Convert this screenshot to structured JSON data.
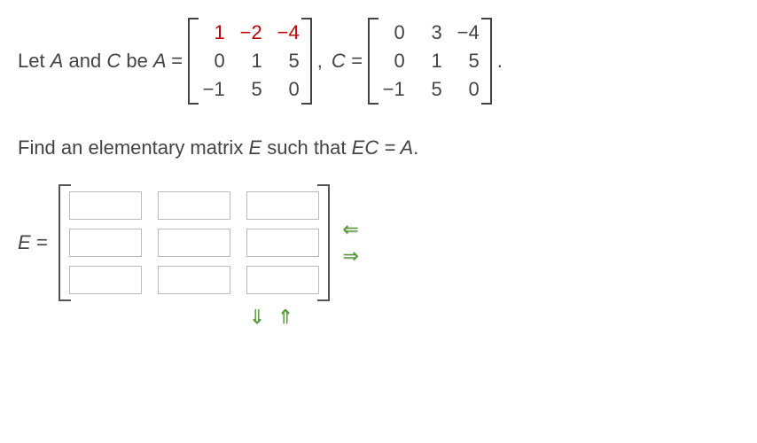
{
  "problem": {
    "intro_prefix": "Let ",
    "var_a": "A",
    "intro_mid": " and ",
    "var_c": "C",
    "intro_suffix": " be  ",
    "a_eq": "A =",
    "c_eq": "C =",
    "comma": ",",
    "period": ".",
    "matrix_a": [
      [
        "1",
        "−2",
        "−4"
      ],
      [
        "0",
        "1",
        "5"
      ],
      [
        "−1",
        "5",
        "0"
      ]
    ],
    "matrix_c": [
      [
        "0",
        "3",
        "−4"
      ],
      [
        "0",
        "1",
        "5"
      ],
      [
        "−1",
        "5",
        "0"
      ]
    ],
    "question_p1": "Find an elementary matrix ",
    "var_e": "E",
    "question_p2": " such that  ",
    "eq_ec": "EC = A",
    "question_p3": "."
  },
  "answer": {
    "e_eq": "E =",
    "grid": [
      [
        "",
        "",
        ""
      ],
      [
        "",
        "",
        ""
      ],
      [
        "",
        "",
        ""
      ]
    ]
  },
  "icons": {
    "arrow_left": "⇐",
    "arrow_right": "⇒",
    "arrow_down": "⇓",
    "arrow_up": "⇑"
  }
}
